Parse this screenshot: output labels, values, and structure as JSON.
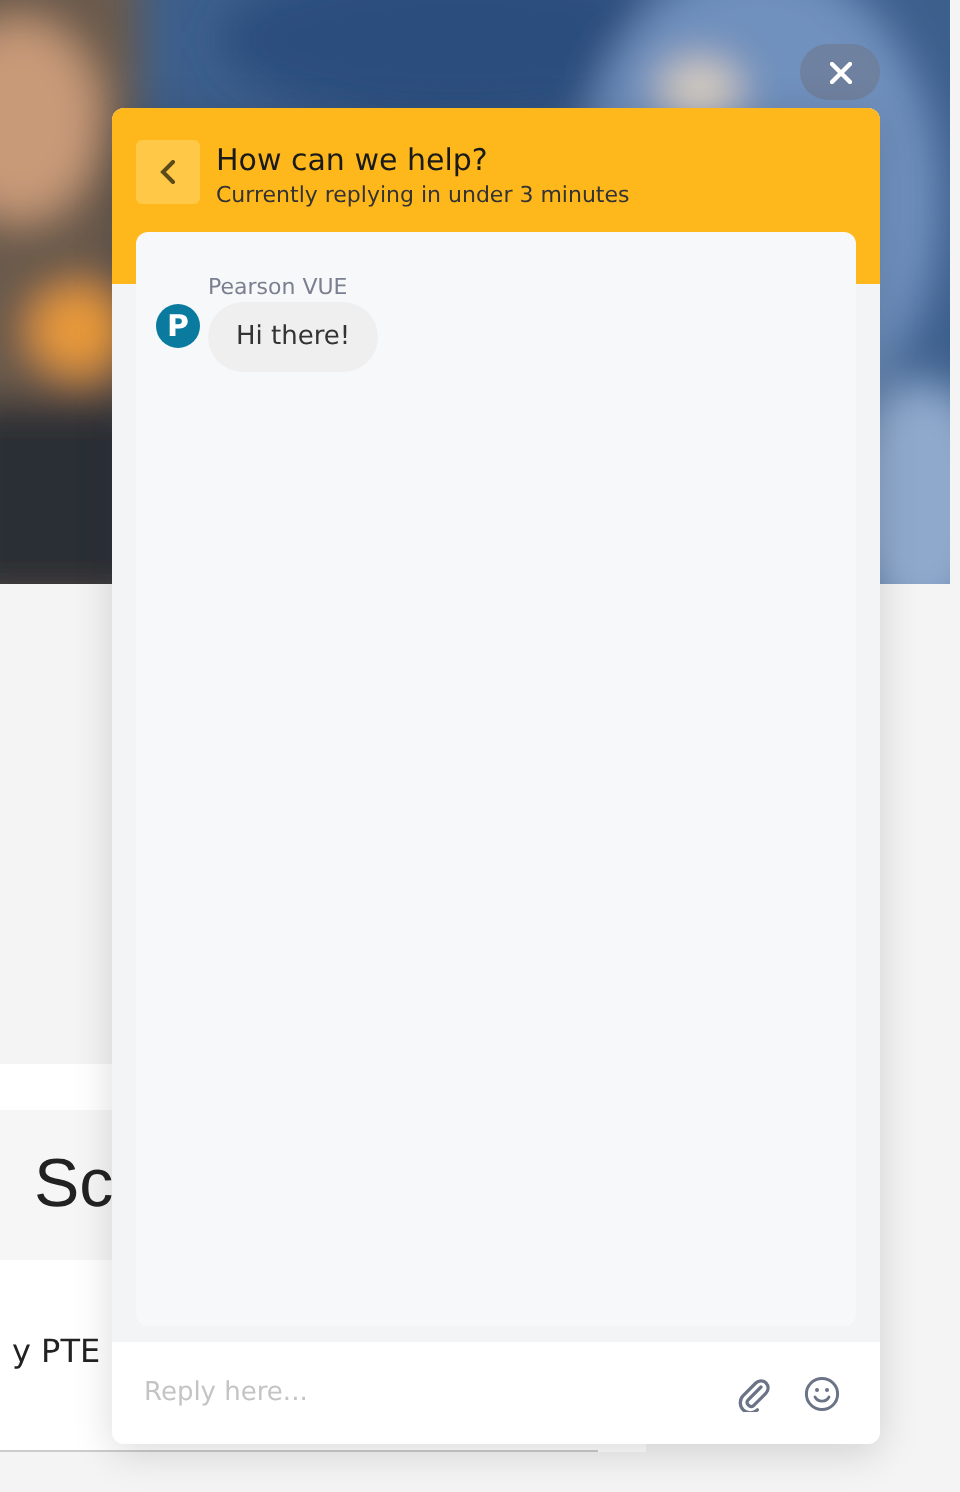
{
  "page": {
    "heading": "Sc",
    "line": "y PTE"
  },
  "chat": {
    "title": "How can we help?",
    "subtitle": "Currently replying in under 3 minutes",
    "messages": [
      {
        "sender": "Pearson VUE",
        "avatar": "P",
        "text": "Hi there!"
      }
    ],
    "composer": {
      "placeholder": "Reply here..."
    }
  }
}
